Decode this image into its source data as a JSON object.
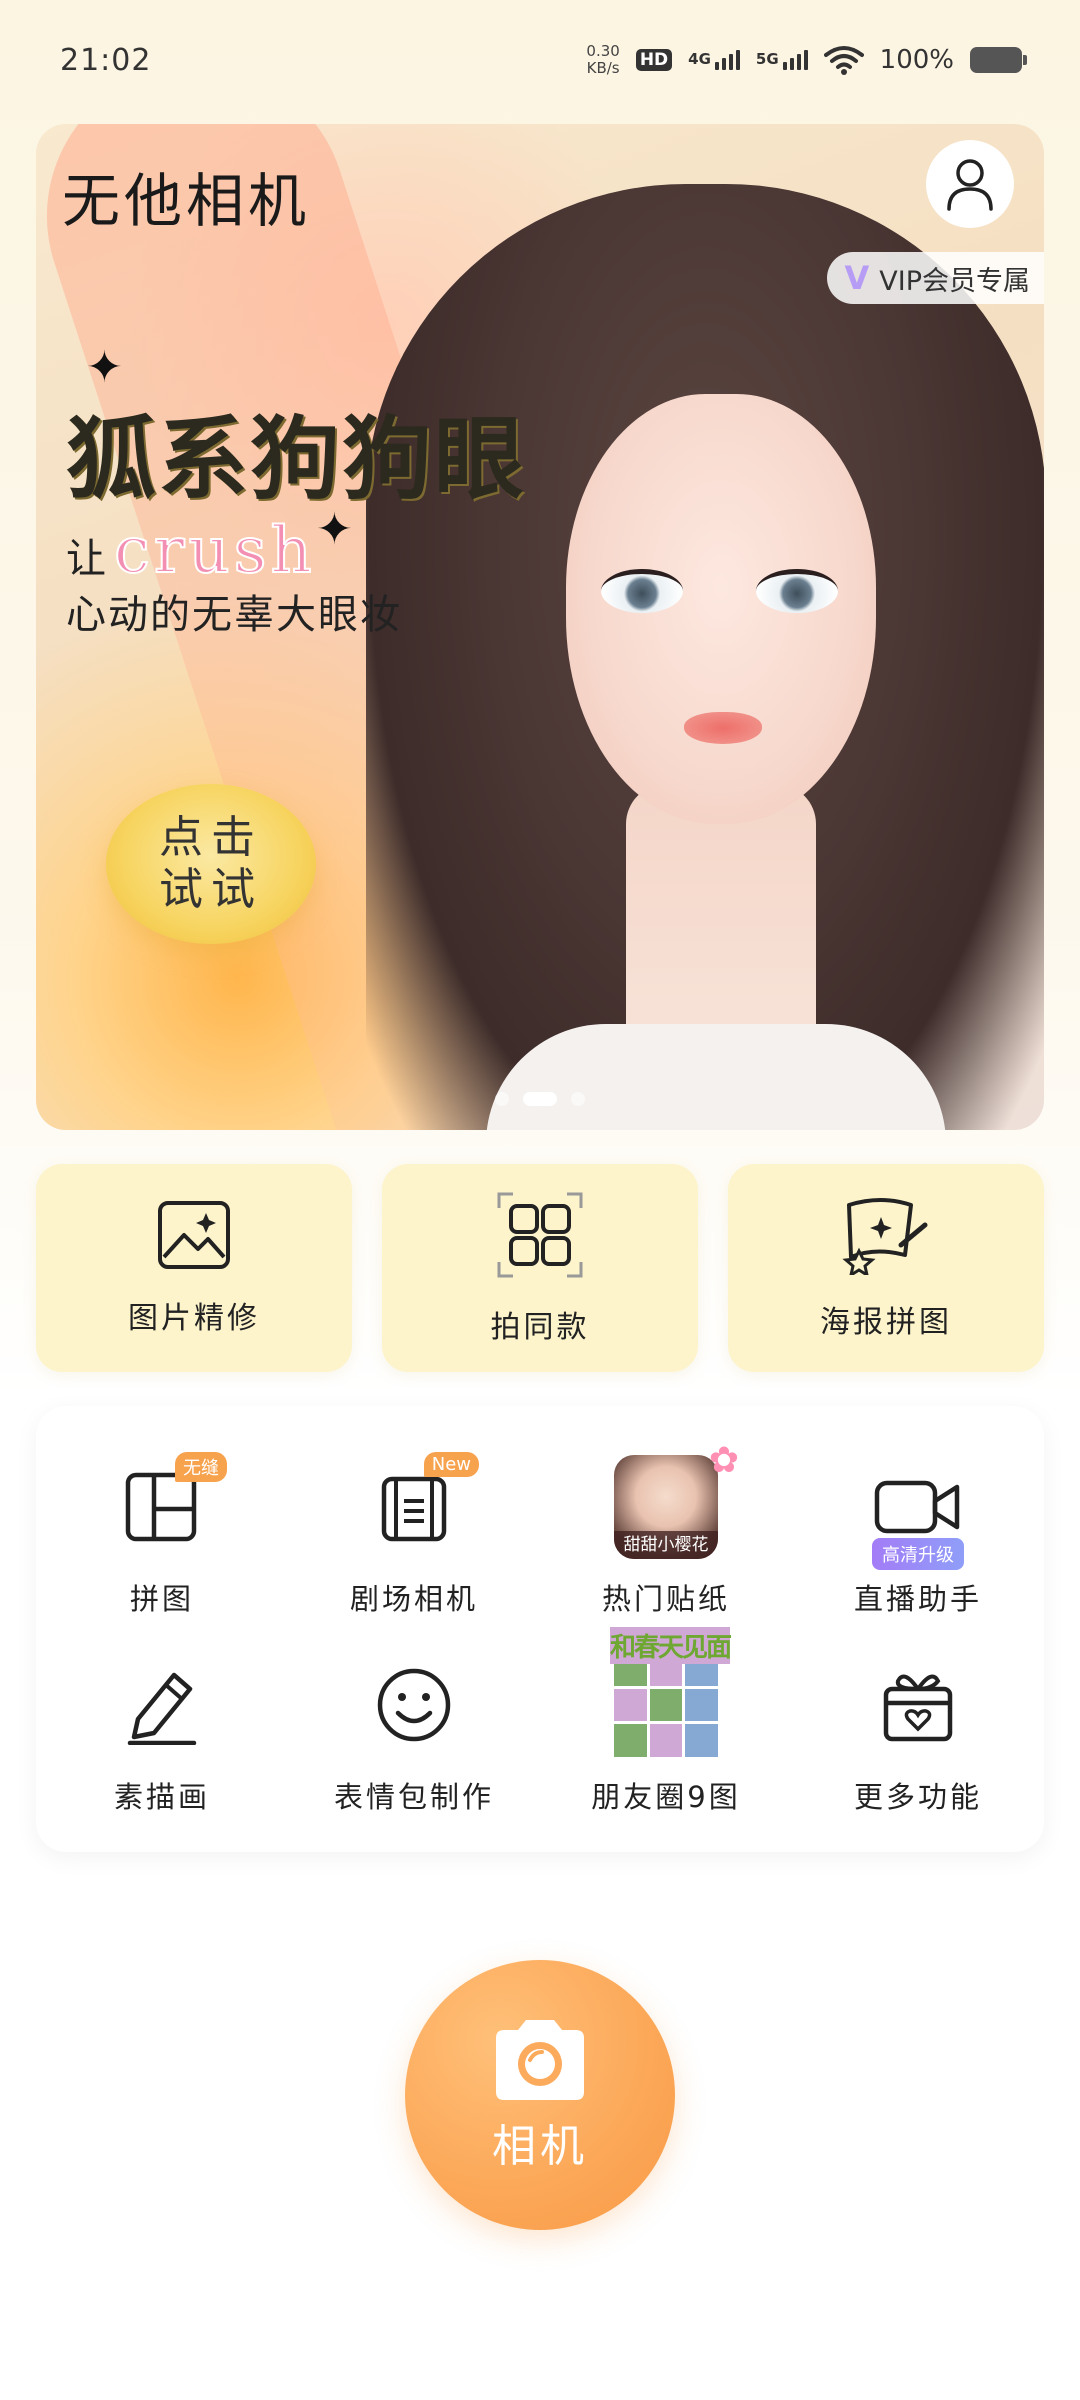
{
  "status_bar": {
    "time": "21:02",
    "net_speed_value": "0.30",
    "net_speed_unit": "KB/s",
    "hd_badge": "HD",
    "signal_1_label": "4G",
    "signal_2_label": "5G",
    "battery_percent": "100%",
    "icons": [
      "hd-call-icon",
      "signal-4g-icon",
      "signal-5g-icon",
      "wifi-icon",
      "battery-icon"
    ]
  },
  "banner": {
    "app_logo": "无他相机",
    "vip_label": "VIP会员专属",
    "vip_mark": "V",
    "headline": "狐系狗狗眼",
    "sub_prefix": "让",
    "sub_highlight": "crush",
    "sub_line2": "心动的无辜大眼妆",
    "cta_line1": "点击",
    "cta_line2": "试试",
    "page_count": 3,
    "active_page": 2,
    "colors": {
      "highlight": "#f38fb3",
      "cta": "#f7d45f"
    }
  },
  "features": [
    {
      "label": "图片精修",
      "icon": "image-icon"
    },
    {
      "label": "拍同款",
      "icon": "grid-scan-icon"
    },
    {
      "label": "海报拼图",
      "icon": "poster-icon"
    }
  ],
  "tools": [
    {
      "label": "拼图",
      "icon": "collage-icon",
      "badge": "无缝"
    },
    {
      "label": "剧场相机",
      "icon": "film-icon",
      "badge": "New"
    },
    {
      "label": "热门贴纸",
      "icon": "sticker-thumbnail",
      "caption": "甜甜小樱花"
    },
    {
      "label": "直播助手",
      "icon": "video-camera-icon",
      "tag": "高清升级"
    },
    {
      "label": "素描画",
      "icon": "pencil-icon"
    },
    {
      "label": "表情包制作",
      "icon": "smiley-icon"
    },
    {
      "label": "朋友圈9图",
      "icon": "nine-grid-thumbnail",
      "caption": "和春天见面"
    },
    {
      "label": "更多功能",
      "icon": "gift-icon"
    }
  ],
  "camera": {
    "label": "相机",
    "color": "#fca95a"
  }
}
